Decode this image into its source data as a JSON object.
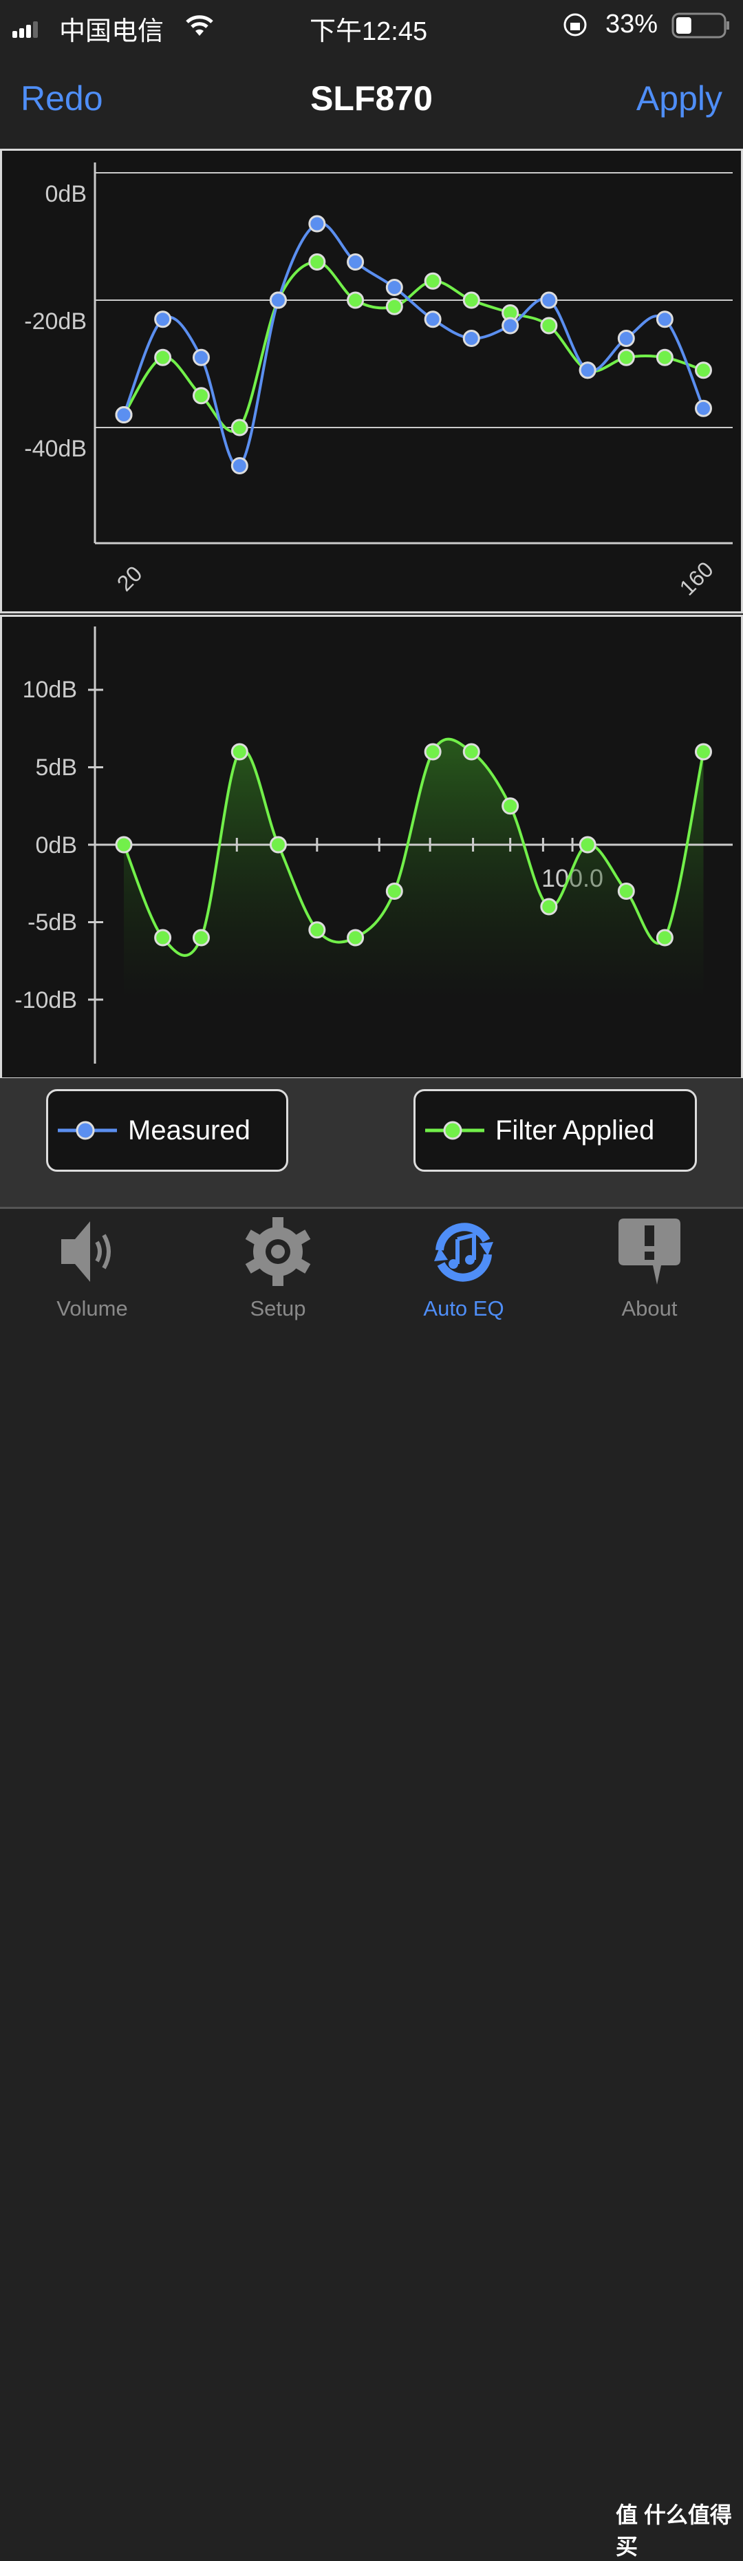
{
  "status": {
    "carrier": "中国电信",
    "time": "下午12:45",
    "battery": "33%",
    "battery_level": 0.33
  },
  "nav": {
    "left": "Redo",
    "title": "SLF870",
    "right": "Apply"
  },
  "colors": {
    "accent": "#4f8ef7",
    "measured": "#5b8ff0",
    "filter": "#72f04a"
  },
  "chart_data": [
    {
      "type": "line",
      "x_scale": "log",
      "xlim": [
        20,
        160
      ],
      "x_tick_labels": [
        "20",
        "160"
      ],
      "y_tick_labels": [
        "0dB",
        "-20dB",
        "-40dB"
      ],
      "ylim": [
        -55,
        3
      ],
      "grid": true,
      "x": [
        20,
        23,
        26.4,
        30.3,
        34.8,
        40,
        45.9,
        52.8,
        60.6,
        69.6,
        80,
        91.9,
        105.6,
        121.3,
        139.3,
        160
      ],
      "series": [
        {
          "name": "Measured",
          "color": "#5b8ff0",
          "values": [
            -38,
            -23,
            -29,
            -46,
            -20,
            -8,
            -14,
            -18,
            -23,
            -26,
            -24,
            -20,
            -31,
            -26,
            -23,
            -37
          ]
        },
        {
          "name": "Filter Applied",
          "color": "#72f04a",
          "values": [
            -38,
            -29,
            -35,
            -40,
            -20,
            -14,
            -20,
            -21,
            -17,
            -20,
            -22,
            -24,
            -31,
            -29,
            -29,
            -31
          ]
        }
      ]
    },
    {
      "type": "area",
      "x_scale": "log",
      "xlim": [
        20,
        160
      ],
      "x_tick_labels": [
        "100.0"
      ],
      "y_tick_labels": [
        "10dB",
        "5dB",
        "0dB",
        "-5dB",
        "-10dB"
      ],
      "ylim": [
        -14,
        14
      ],
      "x": [
        20,
        23,
        26.4,
        30.3,
        34.8,
        40,
        45.9,
        52.8,
        60.6,
        69.6,
        80,
        91.9,
        105.6,
        121.3,
        139.3,
        160
      ],
      "series": [
        {
          "color": "#72f04a",
          "values": [
            0,
            -6,
            -6,
            6,
            0,
            -5.5,
            -6,
            -3,
            6,
            6,
            2.5,
            -4,
            0,
            -3,
            -6,
            6
          ]
        }
      ]
    }
  ],
  "legend": [
    {
      "label": "Measured"
    },
    {
      "label": "Filter Applied"
    }
  ],
  "tabs": [
    {
      "label": "Volume",
      "icon": "speaker-icon"
    },
    {
      "label": "Setup",
      "icon": "gear-icon"
    },
    {
      "label": "Auto EQ",
      "icon": "auto-eq-icon",
      "active": true
    },
    {
      "label": "About",
      "icon": "info-bubble-icon"
    }
  ],
  "watermark": "值 什么值得买"
}
